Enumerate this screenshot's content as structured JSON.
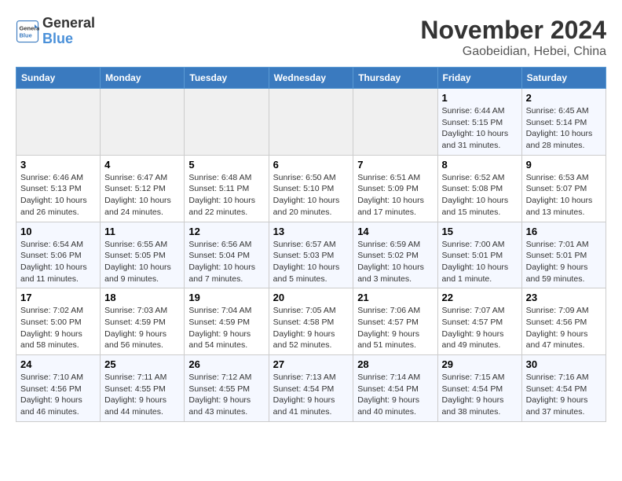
{
  "header": {
    "logo_line1": "General",
    "logo_line2": "Blue",
    "month": "November 2024",
    "location": "Gaobeidian, Hebei, China"
  },
  "weekdays": [
    "Sunday",
    "Monday",
    "Tuesday",
    "Wednesday",
    "Thursday",
    "Friday",
    "Saturday"
  ],
  "weeks": [
    [
      {
        "day": "",
        "info": ""
      },
      {
        "day": "",
        "info": ""
      },
      {
        "day": "",
        "info": ""
      },
      {
        "day": "",
        "info": ""
      },
      {
        "day": "",
        "info": ""
      },
      {
        "day": "1",
        "info": "Sunrise: 6:44 AM\nSunset: 5:15 PM\nDaylight: 10 hours\nand 31 minutes."
      },
      {
        "day": "2",
        "info": "Sunrise: 6:45 AM\nSunset: 5:14 PM\nDaylight: 10 hours\nand 28 minutes."
      }
    ],
    [
      {
        "day": "3",
        "info": "Sunrise: 6:46 AM\nSunset: 5:13 PM\nDaylight: 10 hours\nand 26 minutes."
      },
      {
        "day": "4",
        "info": "Sunrise: 6:47 AM\nSunset: 5:12 PM\nDaylight: 10 hours\nand 24 minutes."
      },
      {
        "day": "5",
        "info": "Sunrise: 6:48 AM\nSunset: 5:11 PM\nDaylight: 10 hours\nand 22 minutes."
      },
      {
        "day": "6",
        "info": "Sunrise: 6:50 AM\nSunset: 5:10 PM\nDaylight: 10 hours\nand 20 minutes."
      },
      {
        "day": "7",
        "info": "Sunrise: 6:51 AM\nSunset: 5:09 PM\nDaylight: 10 hours\nand 17 minutes."
      },
      {
        "day": "8",
        "info": "Sunrise: 6:52 AM\nSunset: 5:08 PM\nDaylight: 10 hours\nand 15 minutes."
      },
      {
        "day": "9",
        "info": "Sunrise: 6:53 AM\nSunset: 5:07 PM\nDaylight: 10 hours\nand 13 minutes."
      }
    ],
    [
      {
        "day": "10",
        "info": "Sunrise: 6:54 AM\nSunset: 5:06 PM\nDaylight: 10 hours\nand 11 minutes."
      },
      {
        "day": "11",
        "info": "Sunrise: 6:55 AM\nSunset: 5:05 PM\nDaylight: 10 hours\nand 9 minutes."
      },
      {
        "day": "12",
        "info": "Sunrise: 6:56 AM\nSunset: 5:04 PM\nDaylight: 10 hours\nand 7 minutes."
      },
      {
        "day": "13",
        "info": "Sunrise: 6:57 AM\nSunset: 5:03 PM\nDaylight: 10 hours\nand 5 minutes."
      },
      {
        "day": "14",
        "info": "Sunrise: 6:59 AM\nSunset: 5:02 PM\nDaylight: 10 hours\nand 3 minutes."
      },
      {
        "day": "15",
        "info": "Sunrise: 7:00 AM\nSunset: 5:01 PM\nDaylight: 10 hours\nand 1 minute."
      },
      {
        "day": "16",
        "info": "Sunrise: 7:01 AM\nSunset: 5:01 PM\nDaylight: 9 hours\nand 59 minutes."
      }
    ],
    [
      {
        "day": "17",
        "info": "Sunrise: 7:02 AM\nSunset: 5:00 PM\nDaylight: 9 hours\nand 58 minutes."
      },
      {
        "day": "18",
        "info": "Sunrise: 7:03 AM\nSunset: 4:59 PM\nDaylight: 9 hours\nand 56 minutes."
      },
      {
        "day": "19",
        "info": "Sunrise: 7:04 AM\nSunset: 4:59 PM\nDaylight: 9 hours\nand 54 minutes."
      },
      {
        "day": "20",
        "info": "Sunrise: 7:05 AM\nSunset: 4:58 PM\nDaylight: 9 hours\nand 52 minutes."
      },
      {
        "day": "21",
        "info": "Sunrise: 7:06 AM\nSunset: 4:57 PM\nDaylight: 9 hours\nand 51 minutes."
      },
      {
        "day": "22",
        "info": "Sunrise: 7:07 AM\nSunset: 4:57 PM\nDaylight: 9 hours\nand 49 minutes."
      },
      {
        "day": "23",
        "info": "Sunrise: 7:09 AM\nSunset: 4:56 PM\nDaylight: 9 hours\nand 47 minutes."
      }
    ],
    [
      {
        "day": "24",
        "info": "Sunrise: 7:10 AM\nSunset: 4:56 PM\nDaylight: 9 hours\nand 46 minutes."
      },
      {
        "day": "25",
        "info": "Sunrise: 7:11 AM\nSunset: 4:55 PM\nDaylight: 9 hours\nand 44 minutes."
      },
      {
        "day": "26",
        "info": "Sunrise: 7:12 AM\nSunset: 4:55 PM\nDaylight: 9 hours\nand 43 minutes."
      },
      {
        "day": "27",
        "info": "Sunrise: 7:13 AM\nSunset: 4:54 PM\nDaylight: 9 hours\nand 41 minutes."
      },
      {
        "day": "28",
        "info": "Sunrise: 7:14 AM\nSunset: 4:54 PM\nDaylight: 9 hours\nand 40 minutes."
      },
      {
        "day": "29",
        "info": "Sunrise: 7:15 AM\nSunset: 4:54 PM\nDaylight: 9 hours\nand 38 minutes."
      },
      {
        "day": "30",
        "info": "Sunrise: 7:16 AM\nSunset: 4:54 PM\nDaylight: 9 hours\nand 37 minutes."
      }
    ]
  ]
}
